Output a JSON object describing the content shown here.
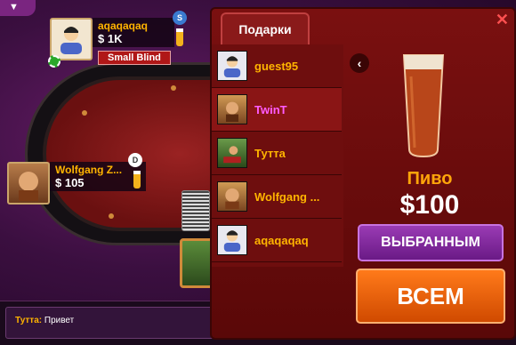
{
  "gifts_panel": {
    "title": "Подарки",
    "close_icon": "close-icon",
    "recipients": [
      {
        "name": "guest95",
        "avatar": "default-avatar-icon"
      },
      {
        "name": "TwinT",
        "avatar": "photo-avatar",
        "selected": true
      },
      {
        "name": "Тутта",
        "avatar": "photo-avatar"
      },
      {
        "name": "Wolfgang ...",
        "avatar": "photo-avatar"
      },
      {
        "name": "aqaqaqaq",
        "avatar": "default-avatar-icon"
      }
    ],
    "gift": {
      "name": "Пиво",
      "price": "$100",
      "icon": "beer-glass-icon"
    },
    "btn_selected": "ВЫБРАННЫМ",
    "btn_all": "ВСЕМ"
  },
  "table": {
    "players": [
      {
        "name": "aqaqaqaq",
        "chips": "$ 1K",
        "role": "Small Blind",
        "marker": "S"
      },
      {
        "name": "Wolfgang Z...",
        "chips": "$ 105",
        "marker": "D"
      }
    ]
  },
  "chat": {
    "author": "Тутта:",
    "message": " Привет"
  },
  "colors": {
    "accent": "#ffb400",
    "panel": "#7a1010",
    "btn_all": "#ff7a1a",
    "btn_selected": "#9a3bb4"
  }
}
